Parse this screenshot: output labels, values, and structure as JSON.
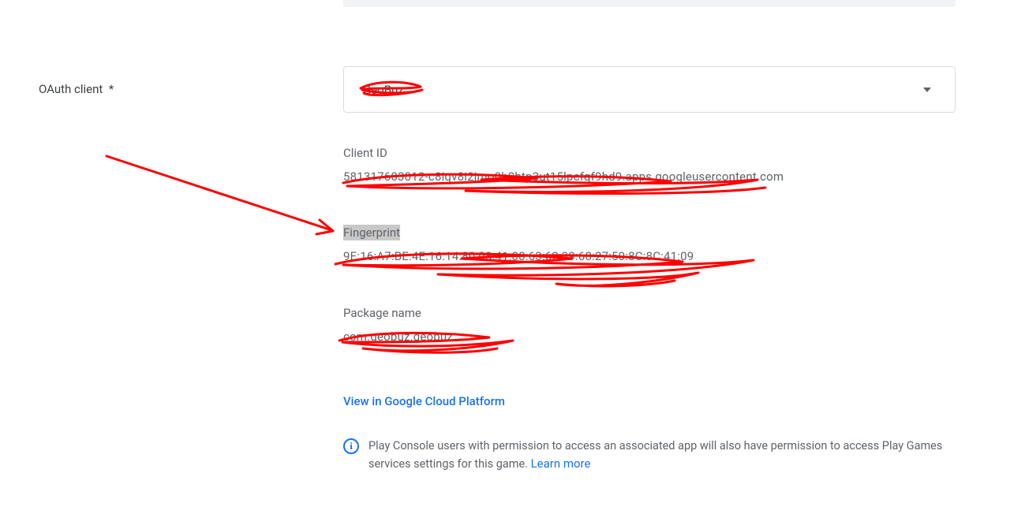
{
  "oauth": {
    "label": "OAuth client",
    "required_mark": "*",
    "selected": "GeoBuz"
  },
  "client_id": {
    "label": "Client ID",
    "value": "581317603012-c8iqv8i2jmo0h0btp3ut15lpcfqf9hd9.apps.googleusercontent.com"
  },
  "fingerprint": {
    "label": "Fingerprint",
    "value": "9E:16:A7:BE:4E:16:14:80:08:41:00:63:62:39:68:27:50:8C:8C:41:09"
  },
  "package": {
    "label": "Package name",
    "value": "com.geobuz.geobuz"
  },
  "cloud_link": "View in Google Cloud Platform",
  "notice": {
    "text_a": "Play Console users with permission to access an associated app will also have permission to access Play Games services settings for this game. ",
    "learn_more": "Learn more"
  }
}
